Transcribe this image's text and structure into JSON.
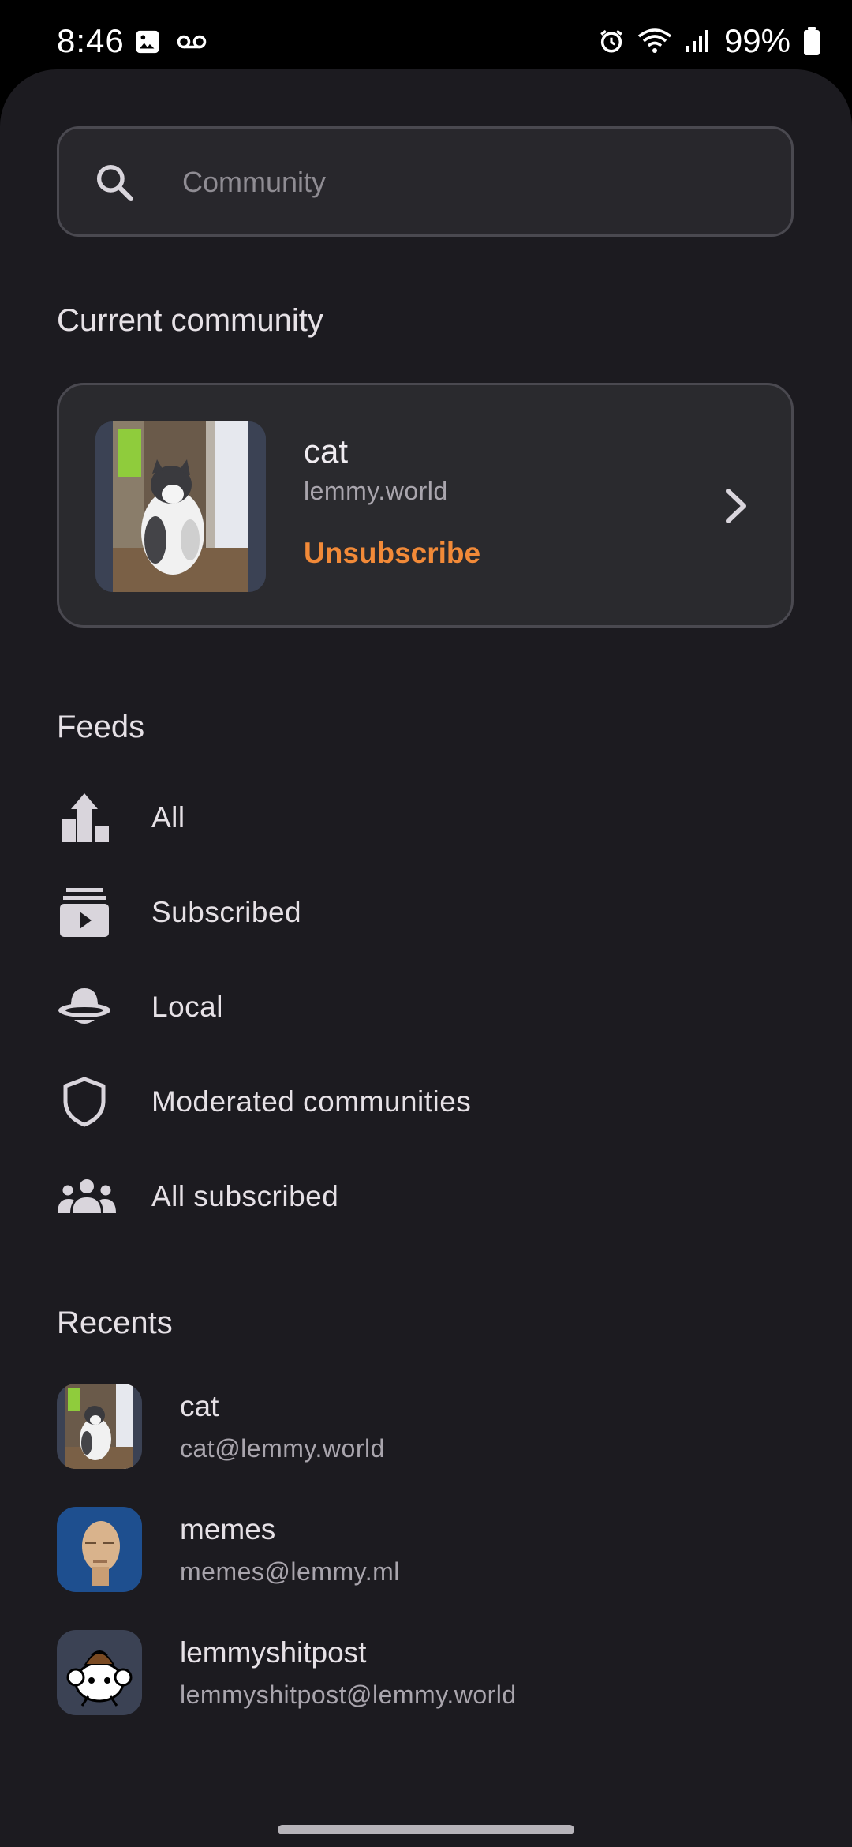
{
  "status_bar": {
    "time": "8:46",
    "battery": "99%"
  },
  "search": {
    "placeholder": "Community",
    "value": ""
  },
  "current_community": {
    "section_title": "Current community",
    "name": "cat",
    "instance": "lemmy.world",
    "action_label": "Unsubscribe",
    "accent_color": "#f28a38"
  },
  "feeds": {
    "section_title": "Feeds",
    "items": [
      {
        "label": "All",
        "icon": "leaderboard-icon"
      },
      {
        "label": "Subscribed",
        "icon": "subscriptions-icon"
      },
      {
        "label": "Local",
        "icon": "ufo-icon"
      },
      {
        "label": "Moderated communities",
        "icon": "shield-icon"
      },
      {
        "label": "All subscribed",
        "icon": "groups-icon"
      }
    ]
  },
  "recents": {
    "section_title": "Recents",
    "items": [
      {
        "name": "cat",
        "handle": "cat@lemmy.world"
      },
      {
        "name": "memes",
        "handle": "memes@lemmy.ml"
      },
      {
        "name": "lemmyshitpost",
        "handle": "lemmyshitpost@lemmy.world"
      }
    ]
  }
}
